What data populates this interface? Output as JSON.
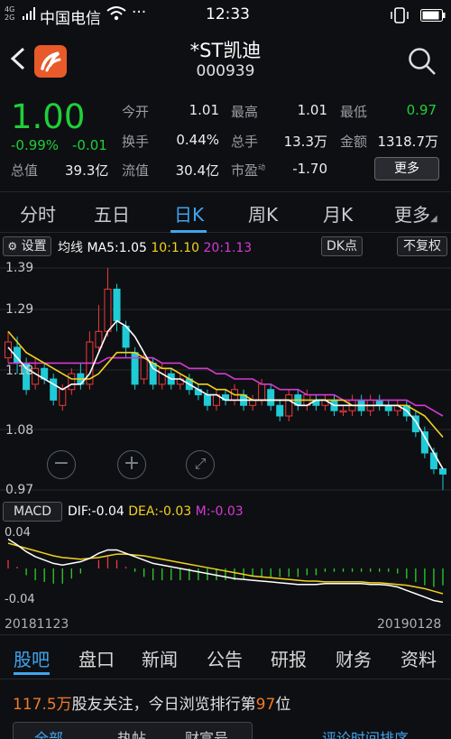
{
  "status_bar": {
    "signal_top": "4G",
    "signal_bottom": "2G",
    "carrier": "中国电信",
    "more": "···",
    "time": "12:33"
  },
  "header": {
    "title": "*ST凯迪",
    "code": "000939"
  },
  "quote": {
    "price": "1.00",
    "change_pct": "-0.99%",
    "change": "-0.01",
    "total_value_label": "总值",
    "total_value": "39.3亿",
    "fields": [
      {
        "label": "今开",
        "value": "1.01"
      },
      {
        "label": "最高",
        "value": "1.01"
      },
      {
        "label": "最低",
        "value": "0.97"
      },
      {
        "label": "换手",
        "value": "0.44%"
      },
      {
        "label": "总手",
        "value": "13.3万"
      },
      {
        "label": "金额",
        "value": "1318.7万"
      },
      {
        "label": "流值",
        "value": "30.4亿"
      },
      {
        "label": "市盈",
        "sup": "动",
        "value": "-1.70"
      }
    ],
    "more_button": "更多"
  },
  "tabs": [
    "分时",
    "五日",
    "日K",
    "周K",
    "月K",
    "更多"
  ],
  "active_tab": "日K",
  "kline": {
    "settings_label": "设置",
    "ma_title": "均线",
    "ma5": "MA5:1.05",
    "ma10": "10:1.10",
    "ma20": "20:1.13",
    "dk_button": "DK点",
    "adjust_button": "不复权",
    "y_labels": [
      "1.39",
      "1.29",
      "1.18",
      "1.08",
      "0.97"
    ],
    "colors": {
      "up": "#ef3b3b",
      "down": "#1ecbd6",
      "ma5": "#ffffff",
      "ma10": "#f2d21e",
      "ma20": "#d63ad6"
    }
  },
  "macd": {
    "title": "MACD",
    "dif": "DIF:-0.04",
    "dea": "DEA:-0.03",
    "m": "M:-0.03",
    "y_top": "0.04",
    "y_bottom": "-0.04",
    "date_start": "20181123",
    "date_end": "20190128"
  },
  "bottom_tabs": [
    "股吧",
    "盘口",
    "新闻",
    "公告",
    "研报",
    "财务",
    "资料"
  ],
  "active_bottom_tab": "股吧",
  "forum": {
    "followers": "117.5万",
    "text1": "股友关注，今日浏览排行第",
    "rank": "97",
    "text2": "位"
  },
  "sub_tabs": [
    "全部",
    "热帖",
    "财富号"
  ],
  "sort_label": "评论时间排序",
  "chart_data": {
    "type": "candlestick",
    "title": "",
    "ylim": [
      0.97,
      1.39
    ],
    "x_range": [
      "20181123",
      "20190128"
    ],
    "candles": [
      {
        "o": 1.22,
        "c": 1.25,
        "h": 1.27,
        "l": 1.21
      },
      {
        "o": 1.24,
        "c": 1.21,
        "h": 1.26,
        "l": 1.19
      },
      {
        "o": 1.21,
        "c": 1.16,
        "h": 1.22,
        "l": 1.15
      },
      {
        "o": 1.17,
        "c": 1.2,
        "h": 1.22,
        "l": 1.16
      },
      {
        "o": 1.2,
        "c": 1.18,
        "h": 1.21,
        "l": 1.17
      },
      {
        "o": 1.18,
        "c": 1.14,
        "h": 1.19,
        "l": 1.13
      },
      {
        "o": 1.13,
        "c": 1.16,
        "h": 1.17,
        "l": 1.12
      },
      {
        "o": 1.16,
        "c": 1.19,
        "h": 1.2,
        "l": 1.15
      },
      {
        "o": 1.19,
        "c": 1.17,
        "h": 1.21,
        "l": 1.16
      },
      {
        "o": 1.17,
        "c": 1.25,
        "h": 1.27,
        "l": 1.16
      },
      {
        "o": 1.24,
        "c": 1.27,
        "h": 1.32,
        "l": 1.23
      },
      {
        "o": 1.27,
        "c": 1.35,
        "h": 1.39,
        "l": 1.26
      },
      {
        "o": 1.35,
        "c": 1.29,
        "h": 1.36,
        "l": 1.27
      },
      {
        "o": 1.28,
        "c": 1.24,
        "h": 1.29,
        "l": 1.22
      },
      {
        "o": 1.23,
        "c": 1.17,
        "h": 1.24,
        "l": 1.16
      },
      {
        "o": 1.18,
        "c": 1.22,
        "h": 1.23,
        "l": 1.17
      },
      {
        "o": 1.21,
        "c": 1.17,
        "h": 1.22,
        "l": 1.16
      },
      {
        "o": 1.17,
        "c": 1.2,
        "h": 1.21,
        "l": 1.16
      },
      {
        "o": 1.19,
        "c": 1.17,
        "h": 1.2,
        "l": 1.16
      },
      {
        "o": 1.17,
        "c": 1.18,
        "h": 1.19,
        "l": 1.16
      },
      {
        "o": 1.18,
        "c": 1.16,
        "h": 1.19,
        "l": 1.15
      },
      {
        "o": 1.16,
        "c": 1.15,
        "h": 1.17,
        "l": 1.14
      },
      {
        "o": 1.15,
        "c": 1.13,
        "h": 1.16,
        "l": 1.12
      },
      {
        "o": 1.13,
        "c": 1.15,
        "h": 1.16,
        "l": 1.12
      },
      {
        "o": 1.15,
        "c": 1.14,
        "h": 1.16,
        "l": 1.13
      },
      {
        "o": 1.14,
        "c": 1.16,
        "h": 1.17,
        "l": 1.13
      },
      {
        "o": 1.15,
        "c": 1.13,
        "h": 1.16,
        "l": 1.12
      },
      {
        "o": 1.13,
        "c": 1.14,
        "h": 1.15,
        "l": 1.12
      },
      {
        "o": 1.14,
        "c": 1.17,
        "h": 1.18,
        "l": 1.13
      },
      {
        "o": 1.16,
        "c": 1.13,
        "h": 1.17,
        "l": 1.12
      },
      {
        "o": 1.13,
        "c": 1.11,
        "h": 1.14,
        "l": 1.1
      },
      {
        "o": 1.11,
        "c": 1.15,
        "h": 1.16,
        "l": 1.1
      },
      {
        "o": 1.15,
        "c": 1.13,
        "h": 1.16,
        "l": 1.12
      },
      {
        "o": 1.13,
        "c": 1.15,
        "h": 1.16,
        "l": 1.12
      },
      {
        "o": 1.14,
        "c": 1.13,
        "h": 1.15,
        "l": 1.12
      },
      {
        "o": 1.13,
        "c": 1.14,
        "h": 1.15,
        "l": 1.12
      },
      {
        "o": 1.14,
        "c": 1.12,
        "h": 1.15,
        "l": 1.11
      },
      {
        "o": 1.12,
        "c": 1.12,
        "h": 1.13,
        "l": 1.11
      },
      {
        "o": 1.12,
        "c": 1.14,
        "h": 1.15,
        "l": 1.11
      },
      {
        "o": 1.14,
        "c": 1.12,
        "h": 1.15,
        "l": 1.11
      },
      {
        "o": 1.12,
        "c": 1.14,
        "h": 1.15,
        "l": 1.11
      },
      {
        "o": 1.14,
        "c": 1.13,
        "h": 1.15,
        "l": 1.12
      },
      {
        "o": 1.13,
        "c": 1.12,
        "h": 1.14,
        "l": 1.11
      },
      {
        "o": 1.12,
        "c": 1.13,
        "h": 1.14,
        "l": 1.11
      },
      {
        "o": 1.13,
        "c": 1.11,
        "h": 1.14,
        "l": 1.1
      },
      {
        "o": 1.11,
        "c": 1.08,
        "h": 1.12,
        "l": 1.07
      },
      {
        "o": 1.08,
        "c": 1.04,
        "h": 1.09,
        "l": 1.03
      },
      {
        "o": 1.04,
        "c": 1.01,
        "h": 1.05,
        "l": 1.0
      },
      {
        "o": 1.01,
        "c": 1.0,
        "h": 1.01,
        "l": 0.97
      }
    ],
    "ma5": [
      1.24,
      1.22,
      1.2,
      1.19,
      1.18,
      1.17,
      1.16,
      1.17,
      1.17,
      1.19,
      1.23,
      1.27,
      1.29,
      1.28,
      1.26,
      1.23,
      1.2,
      1.19,
      1.18,
      1.18,
      1.17,
      1.16,
      1.15,
      1.15,
      1.14,
      1.14,
      1.14,
      1.14,
      1.14,
      1.14,
      1.14,
      1.14,
      1.13,
      1.13,
      1.14,
      1.14,
      1.13,
      1.13,
      1.13,
      1.13,
      1.13,
      1.13,
      1.13,
      1.13,
      1.12,
      1.1,
      1.07,
      1.04,
      1.01
    ],
    "ma10": [
      1.27,
      1.25,
      1.23,
      1.22,
      1.21,
      1.2,
      1.19,
      1.18,
      1.18,
      1.18,
      1.19,
      1.21,
      1.23,
      1.23,
      1.23,
      1.22,
      1.21,
      1.2,
      1.2,
      1.19,
      1.18,
      1.17,
      1.17,
      1.16,
      1.16,
      1.15,
      1.15,
      1.14,
      1.14,
      1.14,
      1.14,
      1.14,
      1.14,
      1.14,
      1.14,
      1.14,
      1.14,
      1.14,
      1.13,
      1.13,
      1.13,
      1.13,
      1.13,
      1.13,
      1.13,
      1.12,
      1.11,
      1.09,
      1.07
    ],
    "ma20": [
      1.21,
      1.21,
      1.21,
      1.21,
      1.21,
      1.21,
      1.21,
      1.21,
      1.21,
      1.21,
      1.21,
      1.22,
      1.22,
      1.22,
      1.22,
      1.22,
      1.22,
      1.21,
      1.21,
      1.21,
      1.2,
      1.2,
      1.2,
      1.19,
      1.19,
      1.18,
      1.18,
      1.18,
      1.17,
      1.17,
      1.16,
      1.16,
      1.16,
      1.15,
      1.15,
      1.15,
      1.15,
      1.14,
      1.14,
      1.14,
      1.14,
      1.14,
      1.14,
      1.14,
      1.14,
      1.13,
      1.13,
      1.12,
      1.11
    ],
    "macd_dif": [
      0.035,
      0.028,
      0.02,
      0.014,
      0.01,
      0.006,
      0.004,
      0.006,
      0.008,
      0.012,
      0.018,
      0.022,
      0.022,
      0.018,
      0.014,
      0.01,
      0.006,
      0.004,
      0.002,
      0.0,
      -0.002,
      -0.004,
      -0.006,
      -0.008,
      -0.01,
      -0.012,
      -0.013,
      -0.014,
      -0.015,
      -0.016,
      -0.017,
      -0.018,
      -0.019,
      -0.019,
      -0.019,
      -0.018,
      -0.018,
      -0.018,
      -0.018,
      -0.018,
      -0.019,
      -0.019,
      -0.02,
      -0.022,
      -0.026,
      -0.03,
      -0.034,
      -0.038,
      -0.04
    ],
    "macd_dea": [
      0.03,
      0.027,
      0.024,
      0.021,
      0.018,
      0.015,
      0.013,
      0.012,
      0.011,
      0.012,
      0.013,
      0.015,
      0.017,
      0.017,
      0.016,
      0.015,
      0.013,
      0.011,
      0.009,
      0.007,
      0.005,
      0.003,
      0.001,
      -0.001,
      -0.003,
      -0.005,
      -0.007,
      -0.009,
      -0.01,
      -0.011,
      -0.012,
      -0.013,
      -0.014,
      -0.015,
      -0.015,
      -0.016,
      -0.016,
      -0.016,
      -0.016,
      -0.016,
      -0.017,
      -0.017,
      -0.018,
      -0.019,
      -0.02,
      -0.022,
      -0.024,
      -0.027,
      -0.03
    ],
    "macd_hist": [
      0.01,
      0.002,
      -0.008,
      -0.014,
      -0.016,
      -0.018,
      -0.018,
      -0.012,
      -0.006,
      0.0,
      0.01,
      0.014,
      0.01,
      0.002,
      -0.004,
      -0.01,
      -0.014,
      -0.014,
      -0.014,
      -0.014,
      -0.014,
      -0.014,
      -0.014,
      -0.014,
      -0.014,
      -0.014,
      -0.012,
      -0.01,
      -0.01,
      -0.01,
      -0.01,
      -0.01,
      -0.01,
      -0.008,
      -0.008,
      -0.004,
      -0.004,
      -0.004,
      -0.004,
      -0.004,
      -0.004,
      -0.004,
      -0.004,
      -0.006,
      -0.012,
      -0.016,
      -0.02,
      -0.022,
      -0.02
    ]
  }
}
